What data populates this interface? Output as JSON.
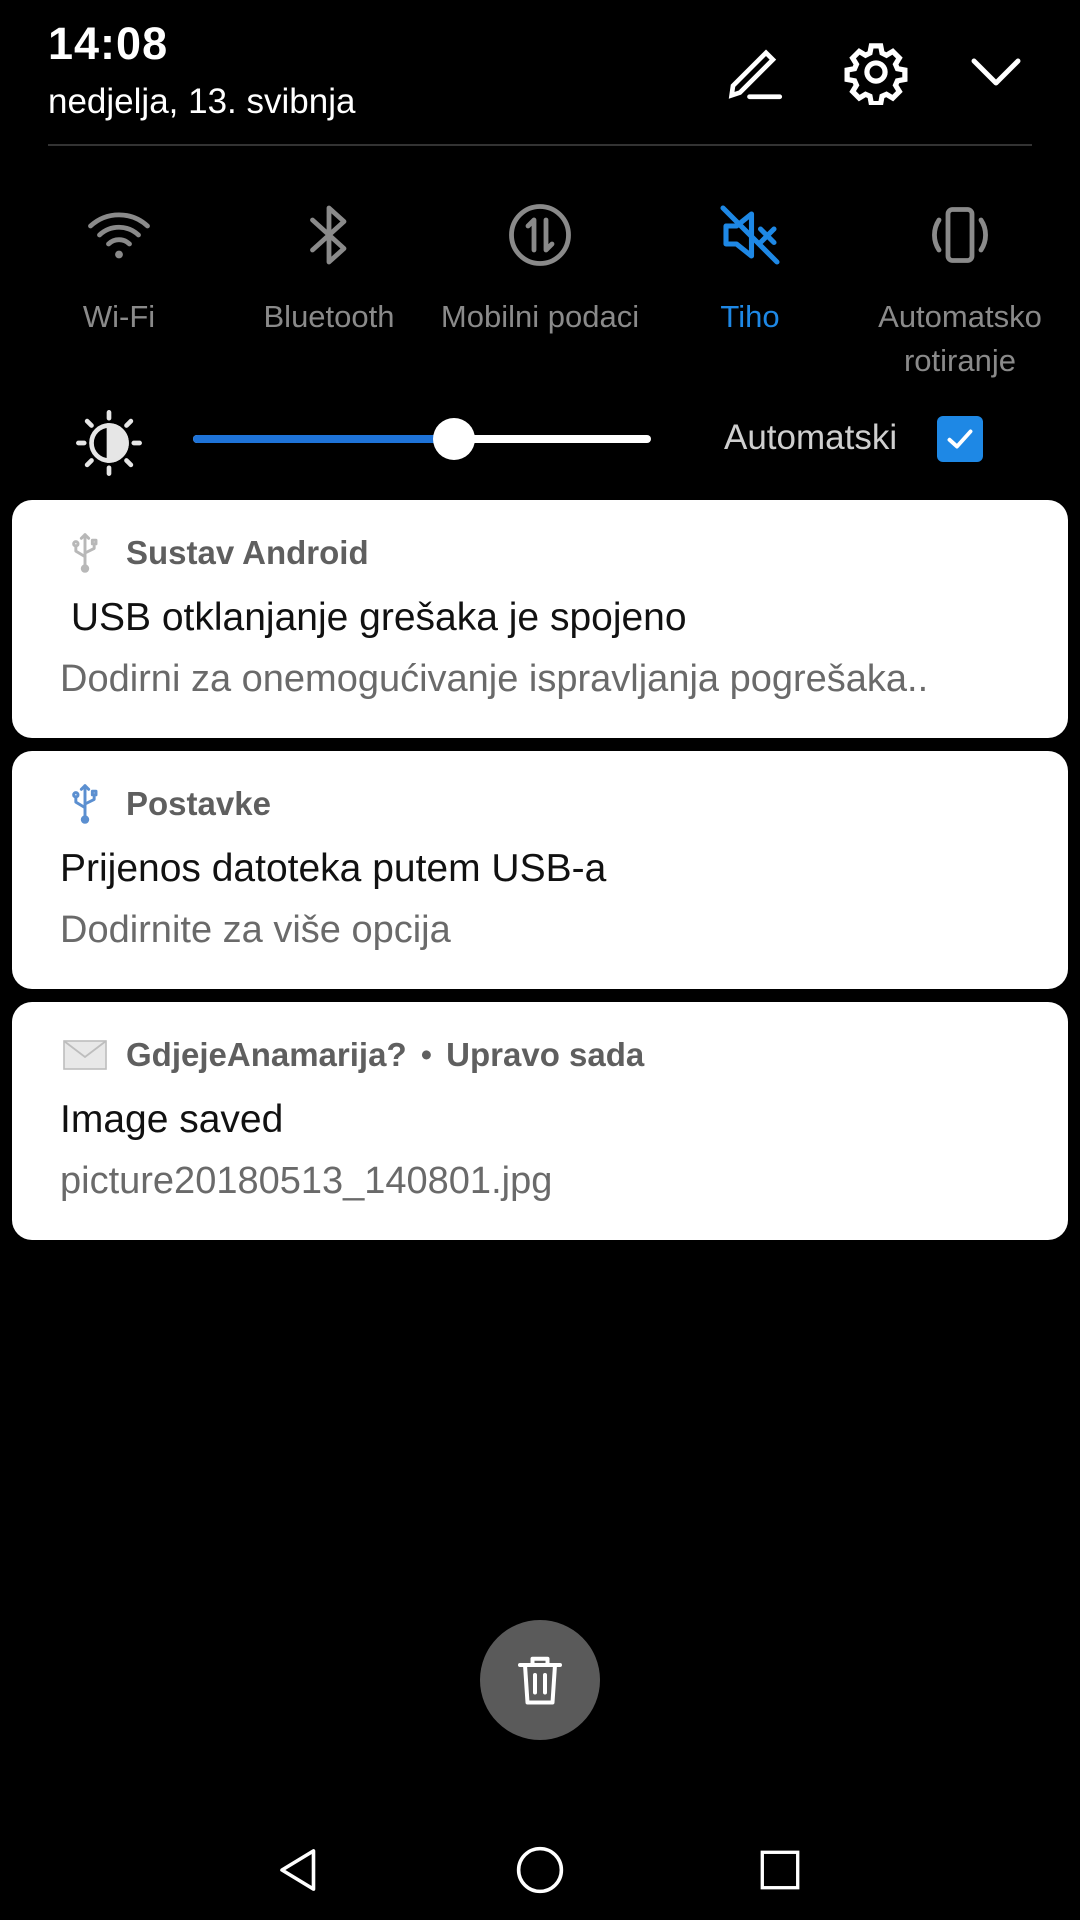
{
  "header": {
    "time": "14:08",
    "date": "nedjelja, 13. svibnja",
    "icons": [
      "edit-icon",
      "gear-icon",
      "chevron-down-icon"
    ]
  },
  "quick_settings": [
    {
      "label": "Wi-Fi",
      "icon": "wifi-icon",
      "active": false
    },
    {
      "label": "Bluetooth",
      "icon": "bluetooth-icon",
      "active": false
    },
    {
      "label": "Mobilni podaci",
      "icon": "mobile-data-icon",
      "active": false
    },
    {
      "label": "Tiho",
      "icon": "silent-icon",
      "active": true
    },
    {
      "label": "Automatsko\nrotiranje",
      "icon": "auto-rotate-icon",
      "active": false
    }
  ],
  "brightness": {
    "level": 0.57,
    "auto_label": "Automatski",
    "auto_checked": true
  },
  "notifications": [
    {
      "app": "Sustav Android",
      "title": " USB otklanjanje grešaka je spojeno",
      "text": "Dodirni za onemogućivanje ispravljanja pogrešaka..",
      "icon": "usb-icon"
    },
    {
      "app": "Postavke",
      "title": "Prijenos datoteka putem USB-a",
      "text": "Dodirnite za više opcija",
      "icon": "usb-icon"
    },
    {
      "app": "GdjejeAnamarija?",
      "time": "Upravo sada",
      "separator": "•",
      "title": "Image saved",
      "text": "picture20180513_140801.jpg",
      "icon": "mail-icon"
    }
  ],
  "actions": {
    "clear_all_icon": "trash-icon"
  },
  "navbar": {
    "icons": [
      "back-icon",
      "home-icon",
      "recents-icon"
    ]
  },
  "colors": {
    "accent": "#1e88e5",
    "background": "#000000",
    "card": "#ffffff"
  }
}
